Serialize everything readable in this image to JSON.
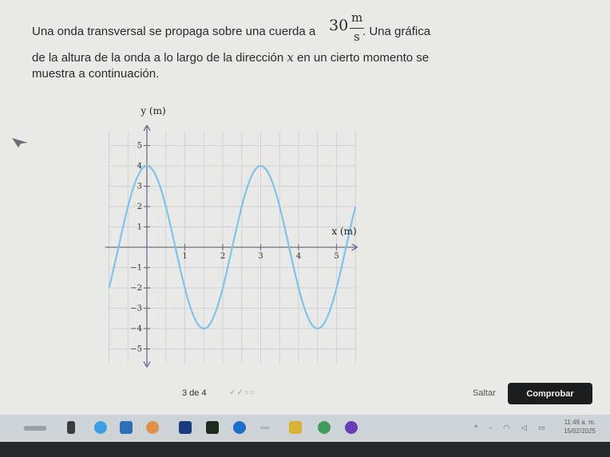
{
  "problem": {
    "line1_before": "Una onda transversal se propaga sobre una cuerda a",
    "speed_value": "30",
    "speed_unit_num": "m",
    "speed_unit_den": "s",
    "line1_after": ". Una gráfica",
    "line2_before": "de la altura de la onda a lo largo de la dirección",
    "line2_var": "x",
    "line2_after": "en un cierto momento se",
    "line3": "muestra a continuación."
  },
  "chart_data": {
    "type": "line",
    "xlabel": "x (m)",
    "ylabel": "y (m)",
    "xlim": [
      -1.1,
      5.6
    ],
    "ylim": [
      -5.8,
      6.0
    ],
    "x_ticks": [
      1,
      2,
      3,
      4,
      5
    ],
    "x_tick_labels": [
      "1",
      "2",
      "3",
      "4",
      "5"
    ],
    "y_ticks": [
      5,
      4,
      3,
      2,
      1,
      -1,
      -2,
      -3,
      -4,
      -5
    ],
    "y_tick_labels": [
      "5",
      "4",
      "3",
      "2",
      "1",
      "−1",
      "−2",
      "−3",
      "−4",
      "−5"
    ],
    "grid": true,
    "series": [
      {
        "amplitude": 4,
        "wavelength": 3,
        "peak_x": 3.0,
        "x_start": -1,
        "x_end": 5.5,
        "color": "#7fc4e6"
      }
    ]
  },
  "controls": {
    "progress": "3 de 4",
    "progress_marks": "✓✓○○",
    "skip_label": "Saltar",
    "check_label": "Comprobar"
  },
  "taskbar": {
    "time": "11:49 a. m.",
    "date": "15/02/2025"
  },
  "colors": {
    "check_button_bg": "#1c1d1f",
    "curve": "#7fc4e6",
    "grid": "#cfd3d6",
    "axis": "#6a6f8a"
  }
}
